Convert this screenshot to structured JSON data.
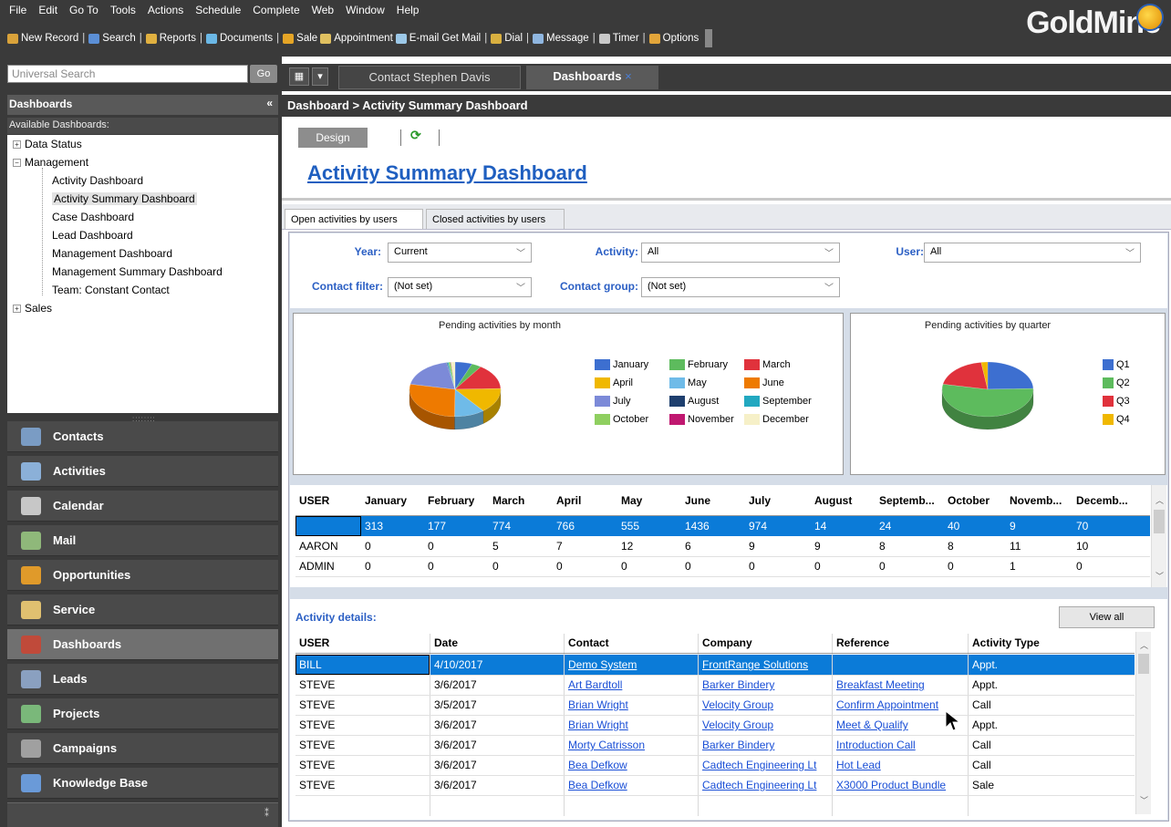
{
  "menu": [
    "File",
    "Edit",
    "Go To",
    "Tools",
    "Actions",
    "Schedule",
    "Complete",
    "Web",
    "Window",
    "Help"
  ],
  "toolbar": [
    {
      "label": "New Record",
      "icon": "new-record-icon",
      "color": "#d9a23a"
    },
    {
      "label": "Search",
      "icon": "search-icon",
      "color": "#5b8fd6"
    },
    {
      "label": "Reports",
      "icon": "reports-icon",
      "color": "#e0b040"
    },
    {
      "label": "Documents",
      "icon": "documents-icon",
      "color": "#6bb8e6"
    },
    {
      "label": "Sale",
      "icon": "sale-icon",
      "color": "#e5a526"
    },
    {
      "label": "Appointment",
      "icon": "appointment-icon",
      "color": "#e0c060"
    },
    {
      "label": "E-mail",
      "icon": "email-icon",
      "color": "#9cc8e8"
    },
    {
      "label": "Get Mail",
      "icon": "",
      "color": ""
    },
    {
      "label": "Dial",
      "icon": "dial-icon",
      "color": "#d9b040"
    },
    {
      "label": "Message",
      "icon": "message-icon",
      "color": "#8fb6e0"
    },
    {
      "label": "Timer",
      "icon": "timer-icon",
      "color": "#c9c9c9"
    },
    {
      "label": "Options",
      "icon": "options-icon",
      "color": "#e2a53a"
    }
  ],
  "logo_text": "GoldMine",
  "search": {
    "placeholder": "Universal Search",
    "go": "Go"
  },
  "sidebar": {
    "header": "Dashboards",
    "collapse": "«",
    "available": "Available Dashboards:",
    "tree": [
      {
        "label": "Data Status",
        "level": 0,
        "expander": "+"
      },
      {
        "label": "Management",
        "level": 0,
        "expander": "−"
      },
      {
        "label": "Activity Dashboard",
        "level": 1
      },
      {
        "label": "Activity Summary Dashboard",
        "level": 1,
        "selected": true
      },
      {
        "label": "Case Dashboard",
        "level": 1
      },
      {
        "label": "Lead Dashboard",
        "level": 1
      },
      {
        "label": "Management Dashboard",
        "level": 1
      },
      {
        "label": "Management Summary Dashboard",
        "level": 1
      },
      {
        "label": "Team: Constant Contact",
        "level": 1
      },
      {
        "label": "Sales",
        "level": 0,
        "expander": "+"
      }
    ],
    "nav": [
      {
        "label": "Contacts",
        "color": "#7a9cc4"
      },
      {
        "label": "Activities",
        "color": "#8bb0d8"
      },
      {
        "label": "Calendar",
        "color": "#c7c7c7"
      },
      {
        "label": "Mail",
        "color": "#8fb87a"
      },
      {
        "label": "Opportunities",
        "color": "#e09a2a"
      },
      {
        "label": "Service",
        "color": "#e0c070"
      },
      {
        "label": "Dashboards",
        "color": "#c04a3a",
        "selected": true
      },
      {
        "label": "Leads",
        "color": "#8aa0c0"
      },
      {
        "label": "Projects",
        "color": "#7ab87a"
      },
      {
        "label": "Campaigns",
        "color": "#a0a0a0"
      },
      {
        "label": "Knowledge Base",
        "color": "#6a9ad8"
      }
    ]
  },
  "tabs": [
    {
      "label": "Contact Stephen Davis"
    },
    {
      "label": "Dashboards",
      "active": true,
      "close": "×"
    }
  ],
  "breadcrumb": "Dashboard > Activity Summary Dashboard",
  "design_button": "Design",
  "dashboard_title": "Activity Summary Dashboard",
  "subtabs": [
    "Open activities by users",
    "Closed activities by users"
  ],
  "filters": {
    "year": {
      "label": "Year:",
      "value": "Current"
    },
    "activity": {
      "label": "Activity:",
      "value": "All"
    },
    "user": {
      "label": "User:",
      "value": "All"
    },
    "contact_filter": {
      "label": "Contact filter:",
      "value": "(Not set)"
    },
    "contact_group": {
      "label": "Contact group:",
      "value": "(Not set)"
    }
  },
  "chart_data": [
    {
      "type": "pie",
      "title": "Pending activities by month",
      "categories": [
        "January",
        "February",
        "March",
        "April",
        "May",
        "June",
        "July",
        "August",
        "September",
        "October",
        "November",
        "December"
      ],
      "values": [
        313,
        177,
        774,
        766,
        555,
        1436,
        974,
        14,
        24,
        40,
        9,
        70
      ],
      "colors": [
        "#3d6fd0",
        "#5dbb5d",
        "#e0323c",
        "#f0b800",
        "#6fbbe8",
        "#ee7a00",
        "#7c8ad8",
        "#1e3f6e",
        "#22a8c0",
        "#8fcf60",
        "#c01870",
        "#f6f0c8"
      ],
      "legend": "right"
    },
    {
      "type": "pie",
      "title": "Pending activities by quarter",
      "categories": [
        "Q1",
        "Q2",
        "Q3",
        "Q4"
      ],
      "values": [
        1264,
        2757,
        1012,
        119
      ],
      "colors": [
        "#3d6fd0",
        "#5dbb5d",
        "#e0323c",
        "#f0b800"
      ],
      "legend": "right"
    }
  ],
  "summary_grid": {
    "headers": [
      "USER",
      "January",
      "February",
      "March",
      "April",
      "May",
      "June",
      "July",
      "August",
      "Septemb...",
      "October",
      "Novemb...",
      "Decemb..."
    ],
    "rows": [
      [
        "",
        "313",
        "177",
        "774",
        "766",
        "555",
        "1436",
        "974",
        "14",
        "24",
        "40",
        "9",
        "70"
      ],
      [
        "AARON",
        "0",
        "0",
        "5",
        "7",
        "12",
        "6",
        "9",
        "9",
        "8",
        "8",
        "11",
        "10"
      ],
      [
        "ADMIN",
        "0",
        "0",
        "0",
        "0",
        "0",
        "0",
        "0",
        "0",
        "0",
        "0",
        "1",
        "0"
      ]
    ]
  },
  "details": {
    "label": "Activity details:",
    "view_all": "View all",
    "headers": [
      "USER",
      "Date",
      "Contact",
      "Company",
      "Reference",
      "Activity Type"
    ],
    "rows": [
      [
        "BILL",
        "4/10/2017",
        "Demo System",
        "FrontRange Solutions",
        "",
        "Appt."
      ],
      [
        "STEVE",
        "3/6/2017",
        "Art Bardtoll",
        "Barker Bindery",
        "Breakfast Meeting",
        "Appt."
      ],
      [
        "STEVE",
        "3/5/2017",
        "Brian Wright",
        "Velocity Group",
        "Confirm Appointment",
        "Call"
      ],
      [
        "STEVE",
        "3/6/2017",
        "Brian Wright",
        "Velocity Group",
        "Meet & Qualify",
        "Appt."
      ],
      [
        "STEVE",
        "3/6/2017",
        "Morty Catrisson",
        "Barker Bindery",
        "Introduction Call",
        "Call"
      ],
      [
        "STEVE",
        "3/6/2017",
        "Bea Defkow",
        "Cadtech Engineering Lt",
        "Hot Lead",
        "Call"
      ],
      [
        "STEVE",
        "3/6/2017",
        "Bea Defkow",
        "Cadtech Engineering Lt",
        "X3000 Product Bundle",
        "Sale"
      ]
    ]
  }
}
